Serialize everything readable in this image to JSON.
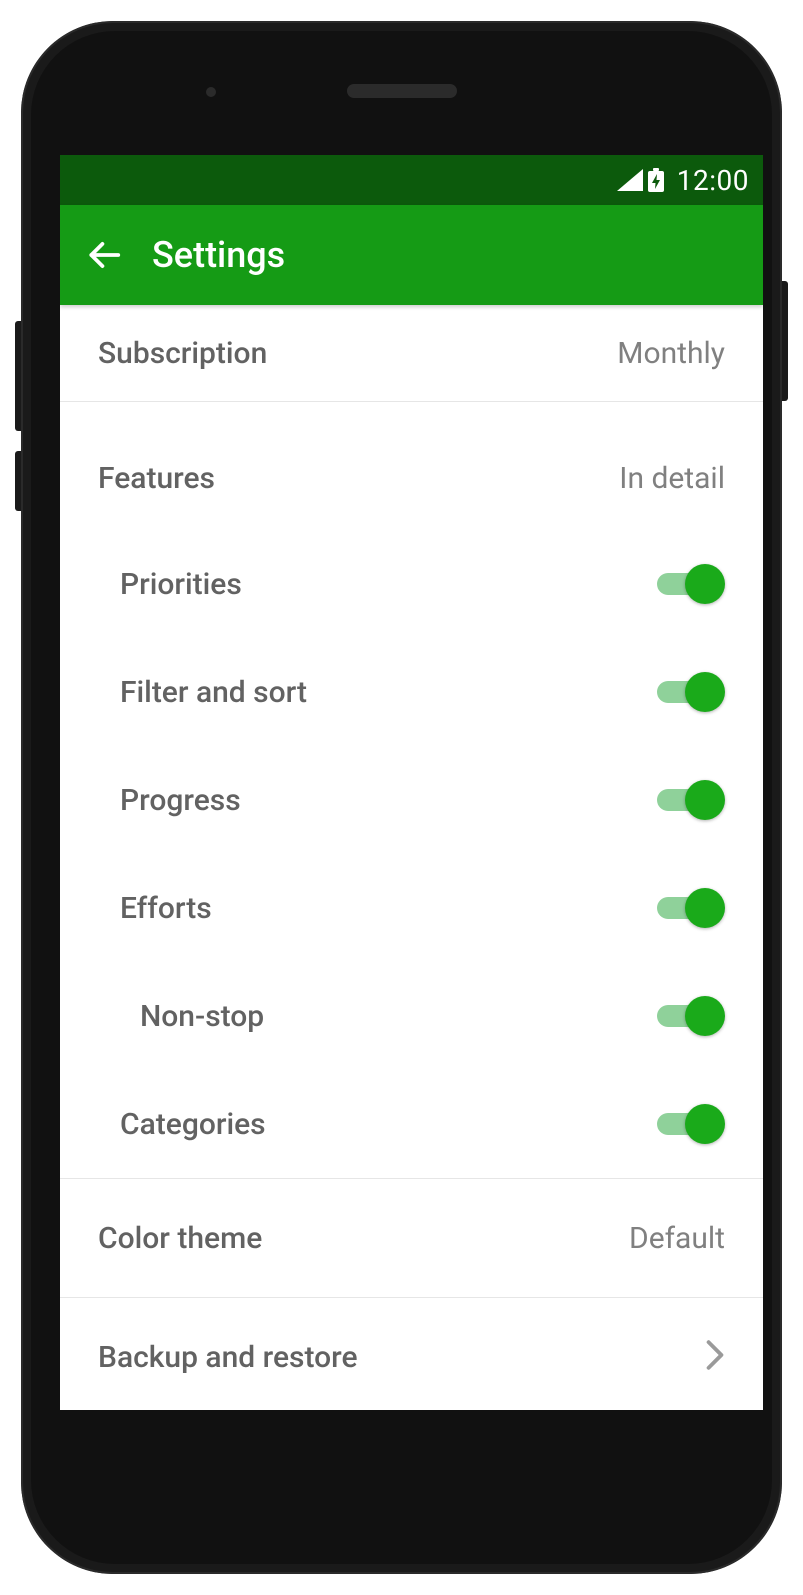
{
  "status": {
    "time": "12:00"
  },
  "appbar": {
    "title": "Settings"
  },
  "subscription": {
    "label": "Subscription",
    "value": "Monthly"
  },
  "features": {
    "header_label": "Features",
    "header_value": "In detail",
    "items": [
      {
        "label": "Priorities",
        "on": true,
        "indent": false
      },
      {
        "label": "Filter and sort",
        "on": true,
        "indent": false
      },
      {
        "label": "Progress",
        "on": true,
        "indent": false
      },
      {
        "label": "Efforts",
        "on": true,
        "indent": false
      },
      {
        "label": "Non-stop",
        "on": true,
        "indent": true
      },
      {
        "label": "Categories",
        "on": true,
        "indent": false
      }
    ]
  },
  "color_theme": {
    "label": "Color theme",
    "value": "Default"
  },
  "backup": {
    "label": "Backup and restore"
  },
  "colors": {
    "status_bar": "#0c5a0c",
    "app_bar": "#159b15",
    "switch_on_thumb": "#1aaa1a",
    "switch_on_track": "#8fd19a"
  }
}
